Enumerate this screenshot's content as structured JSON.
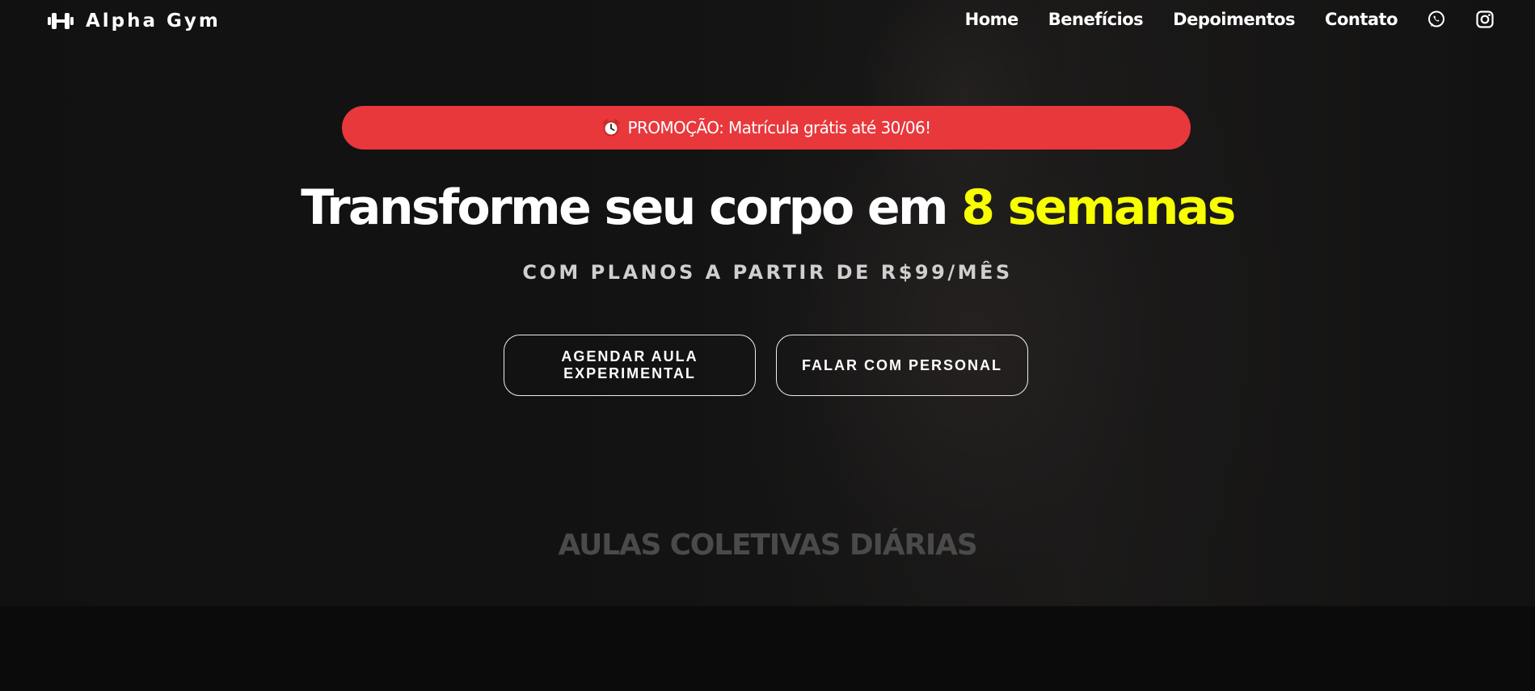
{
  "brand": {
    "name": "Alpha Gym",
    "icon": "dumbbell-icon"
  },
  "nav": {
    "links": [
      "Home",
      "Benefícios",
      "Depoimentos",
      "Contato"
    ],
    "social": [
      "whatsapp-icon",
      "instagram-icon"
    ]
  },
  "promo": {
    "icon": "alarm-clock-icon",
    "text": "PROMOÇÃO: Matrícula grátis até 30/06!",
    "color": "#e8383c"
  },
  "hero": {
    "headline_main": "Transforme seu corpo em ",
    "headline_accent": "8 semanas",
    "accent_color": "#f7ff00",
    "subheadline": "COM PLANOS A PARTIR DE R$99/MÊS",
    "cta_primary": "AGENDAR AULA EXPERIMENTAL",
    "cta_secondary": "FALAR COM PERSONAL"
  },
  "next_section": {
    "title": "AULAS COLETIVAS DIÁRIAS"
  }
}
